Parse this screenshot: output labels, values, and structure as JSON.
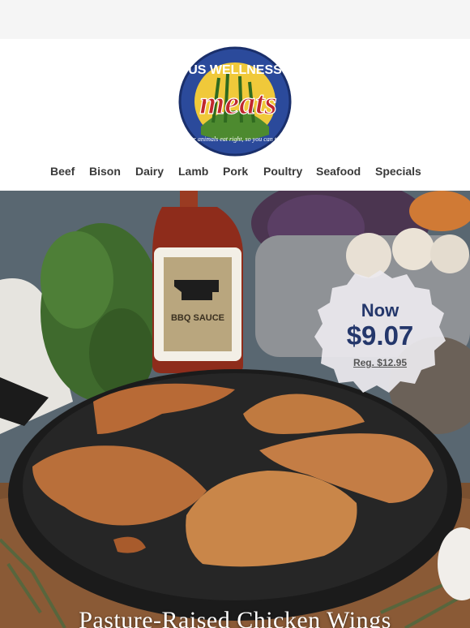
{
  "brand": {
    "logo_top_text": "US WELLNESS",
    "logo_main_text": "meats",
    "logo_tagline": "Our animals eat right, so you can too.",
    "color_navy": "#2b4a9b",
    "color_red": "#c0282d"
  },
  "nav": {
    "items": [
      "Beef",
      "Bison",
      "Dairy",
      "Lamb",
      "Pork",
      "Poultry",
      "Seafood",
      "Specials"
    ]
  },
  "promo": {
    "now_label": "Now",
    "price": "$9.07",
    "regular_price": "Reg. $12.95"
  },
  "hero": {
    "title": "Pasture-Raised Chicken Wings",
    "sauce_label": "BBQ SAUCE"
  }
}
